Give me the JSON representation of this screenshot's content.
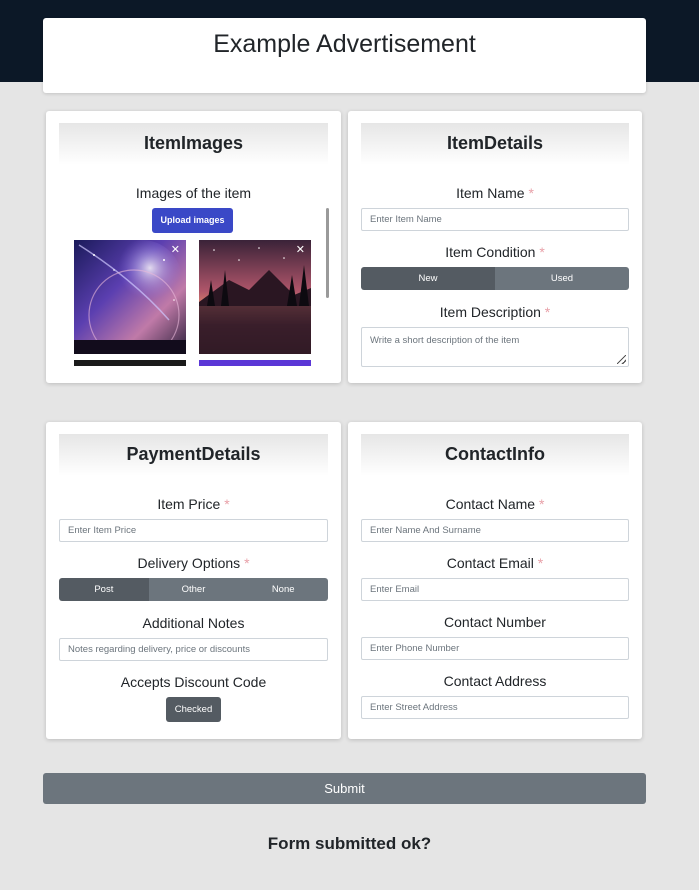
{
  "page": {
    "title": "Example Advertisement"
  },
  "item_images": {
    "heading": "ItemImages",
    "label": "Images of the item",
    "upload_label": "Upload images",
    "close_glyph": "✕"
  },
  "item_details": {
    "heading": "ItemDetails",
    "name_label": "Item Name",
    "name_placeholder": "Enter Item Name",
    "condition_label": "Item Condition",
    "condition_options": [
      "New",
      "Used"
    ],
    "condition_selected": "New",
    "description_label": "Item Description",
    "description_placeholder": "Write a short description of the item"
  },
  "payment_details": {
    "heading": "PaymentDetails",
    "price_label": "Item Price",
    "price_placeholder": "Enter Item Price",
    "delivery_label": "Delivery Options",
    "delivery_options": [
      "Post",
      "Other",
      "None"
    ],
    "delivery_selected": "Post",
    "notes_label": "Additional Notes",
    "notes_placeholder": "Notes regarding delivery, price or discounts",
    "discount_label": "Accepts Discount Code",
    "discount_button": "Checked"
  },
  "contact_info": {
    "heading": "ContactInfo",
    "name_label": "Contact Name",
    "name_placeholder": "Enter Name And Surname",
    "email_label": "Contact Email",
    "email_placeholder": "Enter Email",
    "number_label": "Contact Number",
    "number_placeholder": "Enter Phone Number",
    "address_label": "Contact Address",
    "address_placeholder": "Enter Street Address"
  },
  "required_mark": "*",
  "submit_label": "Submit",
  "status_text": "Form submitted ok?"
}
